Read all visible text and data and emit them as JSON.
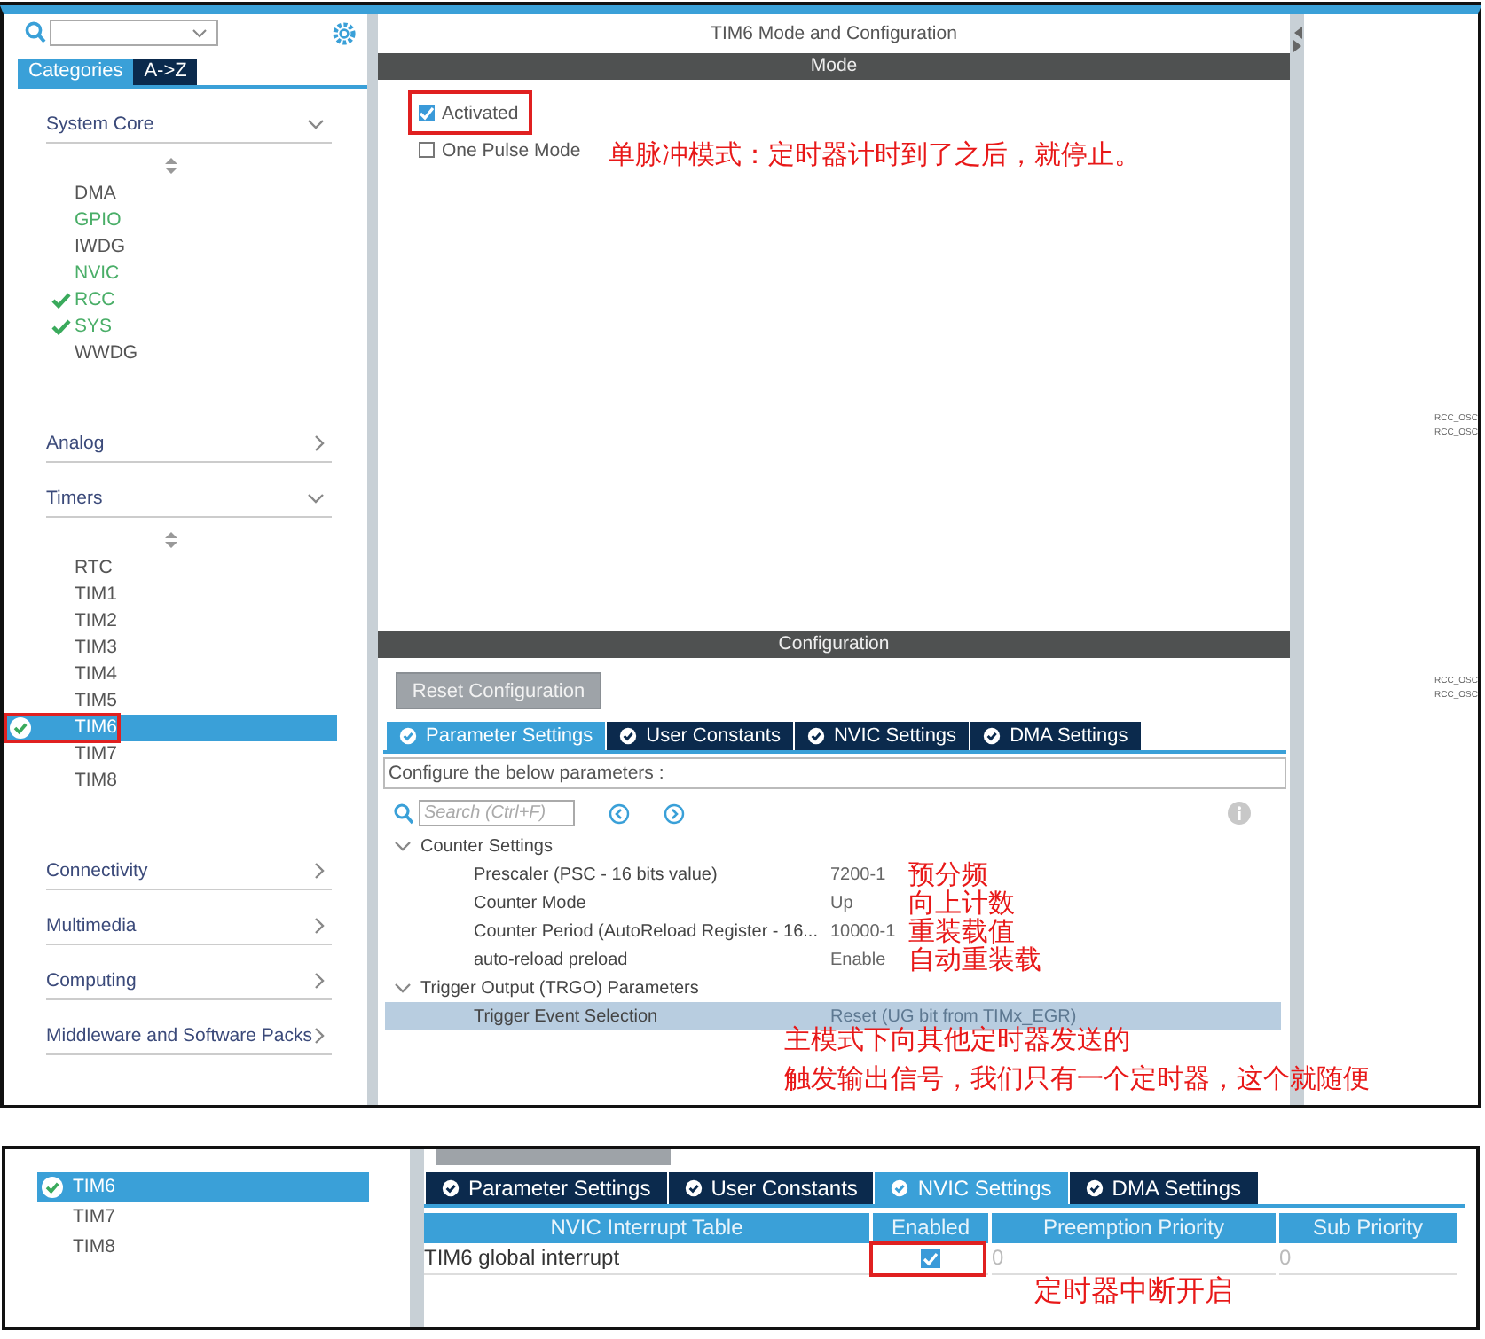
{
  "top": {
    "sidebar": {
      "tabs": [
        {
          "label": "Categories",
          "selected": true
        },
        {
          "label": "A->Z",
          "selected": false
        }
      ],
      "categories": [
        {
          "label": "System Core",
          "expanded": true,
          "items": [
            {
              "label": "DMA",
              "configured": false,
              "checked": false,
              "selected": false,
              "highlighted": false
            },
            {
              "label": "GPIO",
              "configured": true,
              "checked": false,
              "selected": false,
              "highlighted": false
            },
            {
              "label": "IWDG",
              "configured": false,
              "checked": false,
              "selected": false,
              "highlighted": false
            },
            {
              "label": "NVIC",
              "configured": true,
              "checked": false,
              "selected": false,
              "highlighted": false
            },
            {
              "label": "RCC",
              "configured": true,
              "checked": true,
              "selected": false,
              "highlighted": false
            },
            {
              "label": "SYS",
              "configured": true,
              "checked": true,
              "selected": false,
              "highlighted": false
            },
            {
              "label": "WWDG",
              "configured": false,
              "checked": false,
              "selected": false,
              "highlighted": false
            }
          ]
        },
        {
          "label": "Analog",
          "expanded": false
        },
        {
          "label": "Timers",
          "expanded": true,
          "items": [
            {
              "label": "RTC",
              "configured": false,
              "checked": false,
              "selected": false,
              "highlighted": false
            },
            {
              "label": "TIM1",
              "configured": false,
              "checked": false,
              "selected": false,
              "highlighted": false
            },
            {
              "label": "TIM2",
              "configured": false,
              "checked": false,
              "selected": false,
              "highlighted": false
            },
            {
              "label": "TIM3",
              "configured": false,
              "checked": false,
              "selected": false,
              "highlighted": false
            },
            {
              "label": "TIM4",
              "configured": false,
              "checked": false,
              "selected": false,
              "highlighted": false
            },
            {
              "label": "TIM5",
              "configured": false,
              "checked": false,
              "selected": false,
              "highlighted": false
            },
            {
              "label": "TIM6",
              "configured": false,
              "checked": true,
              "selected": true,
              "highlighted": true
            },
            {
              "label": "TIM7",
              "configured": false,
              "checked": false,
              "selected": false,
              "highlighted": false
            },
            {
              "label": "TIM8",
              "configured": false,
              "checked": false,
              "selected": false,
              "highlighted": false
            }
          ]
        },
        {
          "label": "Connectivity",
          "expanded": false
        },
        {
          "label": "Multimedia",
          "expanded": false
        },
        {
          "label": "Computing",
          "expanded": false
        },
        {
          "label": "Middleware and Software Packs",
          "expanded": false
        }
      ]
    },
    "mode": {
      "title": "TIM6 Mode and Configuration",
      "header": "Mode",
      "options": [
        {
          "label": "Activated",
          "checked": true,
          "highlighted": true
        },
        {
          "label": "One Pulse Mode",
          "checked": false,
          "highlighted": false
        }
      ],
      "note": "单脉冲模式：定时器计时到了之后，就停止。"
    },
    "configuration": {
      "header": "Configuration",
      "reset_button": "Reset Configuration",
      "tabs": [
        {
          "label": "Parameter Settings",
          "selected": true
        },
        {
          "label": "User Constants",
          "selected": false
        },
        {
          "label": "NVIC Settings",
          "selected": false
        },
        {
          "label": "DMA Settings",
          "selected": false
        }
      ],
      "description": "Configure the below parameters :",
      "search": {
        "placeholder": "Search (Ctrl+F)"
      },
      "groups": [
        {
          "label": "Counter Settings",
          "expanded": true,
          "params": [
            {
              "name": "Prescaler (PSC - 16 bits value)",
              "value": "7200-1",
              "note": "预分频",
              "selected": false
            },
            {
              "name": "Counter Mode",
              "value": "Up",
              "note": "向上计数",
              "selected": false
            },
            {
              "name": "Counter Period (AutoReload Register - 16...",
              "value": "10000-1",
              "note": "重装载值",
              "selected": false
            },
            {
              "name": "auto-reload preload",
              "value": "Enable",
              "note": "自动重装载",
              "selected": false
            }
          ]
        },
        {
          "label": "Trigger Output (TRGO) Parameters",
          "expanded": true,
          "params": [
            {
              "name": "Trigger Event Selection",
              "value": "Reset (UG bit from TIMx_EGR)",
              "selected": true
            }
          ]
        }
      ],
      "notes": [
        "主模式下向其他定时器发送的",
        "触发输出信号，我们只有一个定时器，这个就随便"
      ]
    },
    "canvas": {
      "label_groups": [
        [
          "RCC_OSC",
          "RCC_OSC"
        ],
        [
          "RCC_OSC",
          "RCC_OSC"
        ]
      ]
    }
  },
  "bottom": {
    "sidebar": {
      "items": [
        {
          "label": "TIM6",
          "checked": true,
          "selected": true
        },
        {
          "label": "TIM7",
          "checked": false,
          "selected": false
        },
        {
          "label": "TIM8",
          "checked": false,
          "selected": false
        }
      ]
    },
    "tabs": [
      {
        "label": "Parameter Settings",
        "selected": false
      },
      {
        "label": "User Constants",
        "selected": false
      },
      {
        "label": "NVIC Settings",
        "selected": true
      },
      {
        "label": "DMA Settings",
        "selected": false
      }
    ],
    "table": {
      "columns": [
        "NVIC Interrupt Table",
        "Enabled",
        "Preemption Priority",
        "Sub Priority"
      ],
      "rows": [
        {
          "name": "TIM6 global interrupt",
          "enabled": true,
          "highlighted": true,
          "preemption_priority": "0",
          "sub_priority": "0"
        }
      ]
    },
    "note": "定时器中断开启"
  }
}
